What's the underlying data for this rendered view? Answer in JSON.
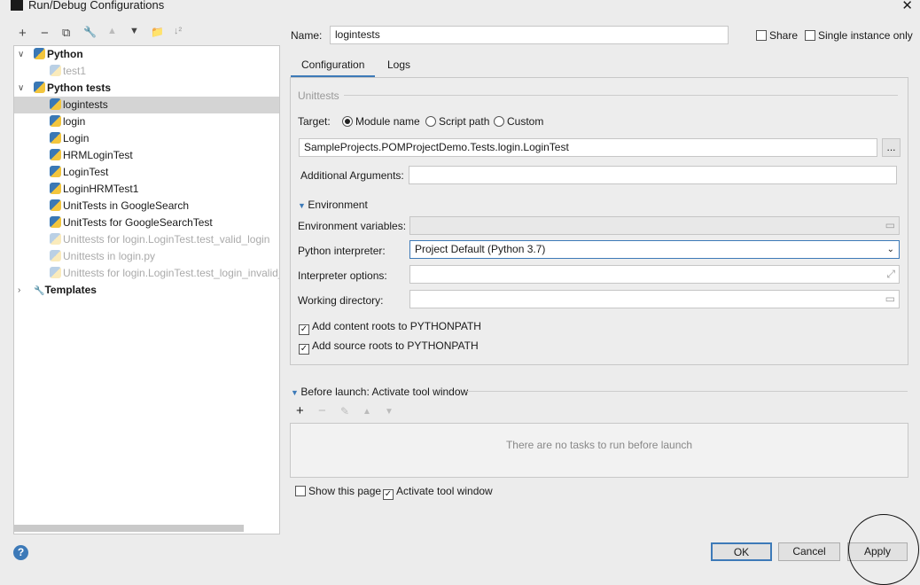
{
  "window": {
    "title": "Run/Debug Configurations",
    "close": "✕"
  },
  "toolbar": [
    "+",
    "−",
    "⧉",
    "🔧",
    "▲",
    "▼",
    "📁",
    "↓²"
  ],
  "tree": [
    {
      "label": "Python",
      "level": 0,
      "bold": true,
      "expanded": true
    },
    {
      "label": "test1",
      "level": 1,
      "dim": true
    },
    {
      "label": "Python tests",
      "level": 0,
      "bold": true,
      "expanded": true
    },
    {
      "label": "logintests",
      "level": 1,
      "selected": true
    },
    {
      "label": "login",
      "level": 1
    },
    {
      "label": "Login",
      "level": 1
    },
    {
      "label": "HRMLoginTest",
      "level": 1
    },
    {
      "label": "LoginTest",
      "level": 1
    },
    {
      "label": "LoginHRMTest1",
      "level": 1
    },
    {
      "label": "UnitTests in GoogleSearch",
      "level": 1
    },
    {
      "label": "UnitTests for GoogleSearchTest",
      "level": 1
    },
    {
      "label": "Unittests for login.LoginTest.test_valid_login",
      "level": 1,
      "dim": true
    },
    {
      "label": "Unittests in login.py",
      "level": 1,
      "dim": true
    },
    {
      "label": "Unittests for login.LoginTest.test_login_invalid_u",
      "level": 1,
      "dim": true
    },
    {
      "label": "Templates",
      "level": 0,
      "bold": true,
      "collapsed": true
    }
  ],
  "form": {
    "name_label": "Name:",
    "name_value": "logintests",
    "share": "Share",
    "single": "Single instance only",
    "tabs": [
      "Configuration",
      "Logs"
    ],
    "unittests": "Unittests",
    "target": "Target:",
    "module": "Module name",
    "script": "Script path",
    "custom": "Custom",
    "target_value": "SampleProjects.POMProjectDemo.Tests.login.LoginTest",
    "browse": "...",
    "additional": "Additional Arguments:",
    "environment": "Environment",
    "env_vars": "Environment variables:",
    "interpreter": "Python interpreter:",
    "interpreter_value": "Project Default (Python 3.7)",
    "interp_options": "Interpreter options:",
    "working_dir": "Working directory:",
    "content_roots": "Add content roots to PYTHONPATH",
    "source_roots": "Add source roots to PYTHONPATH",
    "before_launch": "Before launch: Activate tool window",
    "no_tasks": "There are no tasks to run before launch",
    "show_page": "Show this page",
    "activate": "Activate tool window"
  },
  "buttons": {
    "ok": "OK",
    "cancel": "Cancel",
    "apply": "Apply",
    "help": "?"
  }
}
